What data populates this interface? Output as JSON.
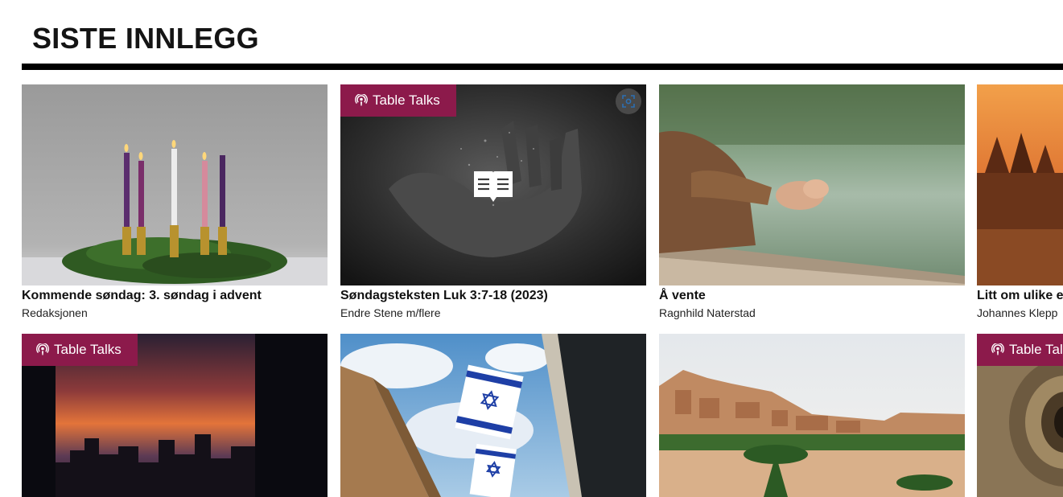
{
  "section": {
    "title": "SISTE INNLEGG"
  },
  "badge_label": "Table Talks",
  "posts": [
    {
      "title": "Kommende søndag: 3. søndag i advent",
      "author": "Redaksjonen",
      "image": "advent-candles-wreath"
    },
    {
      "title": "Søndagsteksten Luk 3:7-18 (2023)",
      "author": "Endre Stene m/flere",
      "image": "hand-in-water-dark",
      "badge": "Table Talks"
    },
    {
      "title": "Å vente",
      "author": "Ragnhild Naterstad",
      "image": "hands-resting-on-railing-by-lake"
    },
    {
      "title": "Litt om ulike e",
      "author": "Johannes Klepp",
      "image": "sunset-forest"
    },
    {
      "image": "city-skyline-sunset",
      "badge": "Table Talks"
    },
    {
      "image": "israeli-flags-on-building"
    },
    {
      "image": "desert-village-with-palms"
    },
    {
      "image": "rock-spiral-texture",
      "badge": "Table Tal"
    }
  ],
  "icons": {
    "badge_icon": "podcast-icon",
    "corner_icon": "focus-scan-icon",
    "reader_icon": "open-book-icon"
  },
  "colors": {
    "badge_bg": "#8c1a4b",
    "rule": "#000000"
  }
}
